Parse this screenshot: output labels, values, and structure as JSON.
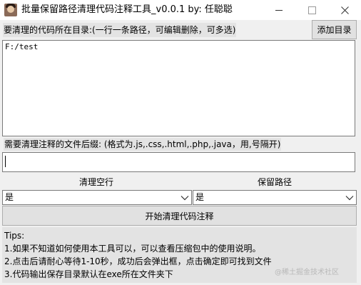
{
  "window": {
    "title": "批量保留路径清理代码注释工具_v0.0.1    by: 任聪聪"
  },
  "header": {
    "dir_label": "要清理的代码所在目录:(一行一条路径，可编辑删除，可多选)",
    "add_dir_button": "添加目录"
  },
  "dirs": {
    "value": "F:/test"
  },
  "suffix": {
    "label": "需要清理注释的文件后缀: (格式为.js,.css,.html,.php,.java，用,号隔开)",
    "value": ""
  },
  "options": {
    "clear_empty_label": "清理空行",
    "clear_empty_value": "是",
    "keep_path_label": "保留路径",
    "keep_path_value": "是"
  },
  "start_button": "开始清理代码注释",
  "tips": {
    "heading": "Tips:",
    "lines": [
      "1.如果不知道如何使用本工具可以，可以查看压缩包中的使用说明。",
      "2.点击后请耐心等待1-10秒，成功后会弹出框，点击确定即可找到文件",
      "3.代码输出保存目录默认在exe所在文件夹下"
    ]
  },
  "watermark": "@稀土掘金技术社区",
  "icons": {
    "app": "avatar-app-icon",
    "minimize": "minimize-icon",
    "maximize": "maximize-icon",
    "close": "close-icon",
    "dropdown": "chevron-down-icon"
  }
}
